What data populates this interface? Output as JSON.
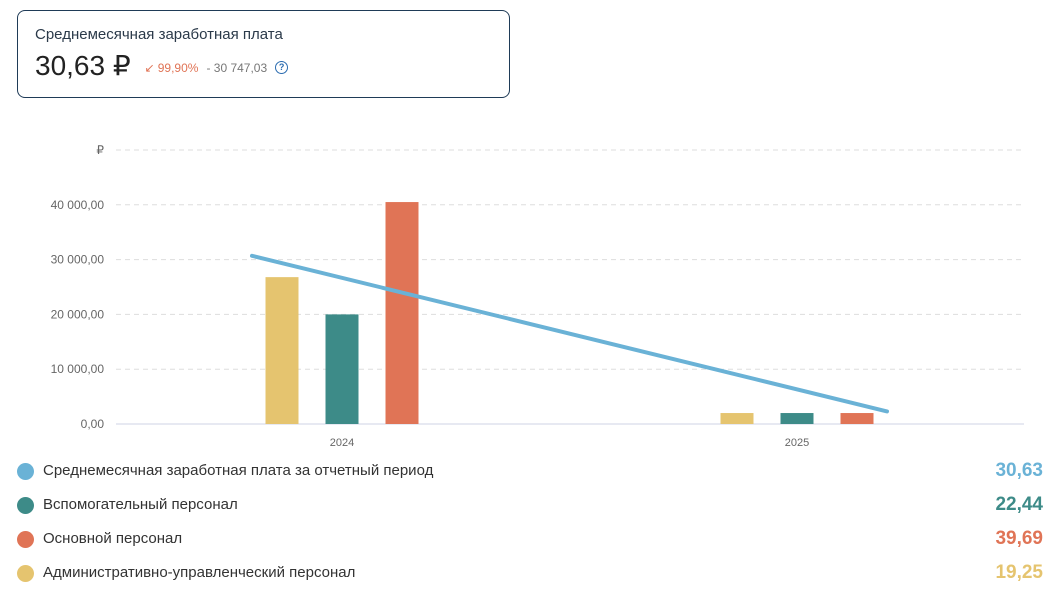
{
  "kpi": {
    "title": "Среднемесячная заработная плата",
    "value": "30,63 ₽",
    "delta_arrow": "↙",
    "delta_pct": "99,90%",
    "delta_abs": "- 30 747,03",
    "help": "?"
  },
  "colors": {
    "line": "#6ab2d6",
    "aux": "#3d8b88",
    "main": "#e07456",
    "admin": "#e5c46f",
    "grid": "#dddddd",
    "axis_text": "#666666"
  },
  "chart_data": {
    "type": "bar",
    "categories": [
      "2024",
      "2025"
    ],
    "y_unit_label": "₽",
    "y_ticks": [
      "0,00",
      "10 000,00",
      "20 000,00",
      "30 000,00",
      "40 000,00"
    ],
    "ylim": [
      0,
      50000
    ],
    "grid": true,
    "series": [
      {
        "name": "Административно-управленческий персонал",
        "color": "#e5c46f",
        "values": [
          26800,
          2000
        ]
      },
      {
        "name": "Вспомогательный персонал",
        "color": "#3d8b88",
        "values": [
          20000,
          2000
        ]
      },
      {
        "name": "Основной персонал",
        "color": "#e07456",
        "values": [
          40500,
          2000
        ]
      }
    ],
    "line_series": {
      "name": "Среднемесячная заработная плата за отчетный период",
      "color": "#6ab2d6",
      "values": [
        30700,
        2300
      ]
    }
  },
  "legend": [
    {
      "label": "Среднемесячная заработная плата за отчетный период",
      "value": "30,63",
      "color": "#6ab2d6"
    },
    {
      "label": "Вспомогательный персонал",
      "value": "22,44",
      "color": "#3d8b88"
    },
    {
      "label": "Основной персонал",
      "value": "39,69",
      "color": "#e07456"
    },
    {
      "label": "Административно-управленческий персонал",
      "value": "19,25",
      "color": "#e5c46f"
    }
  ]
}
